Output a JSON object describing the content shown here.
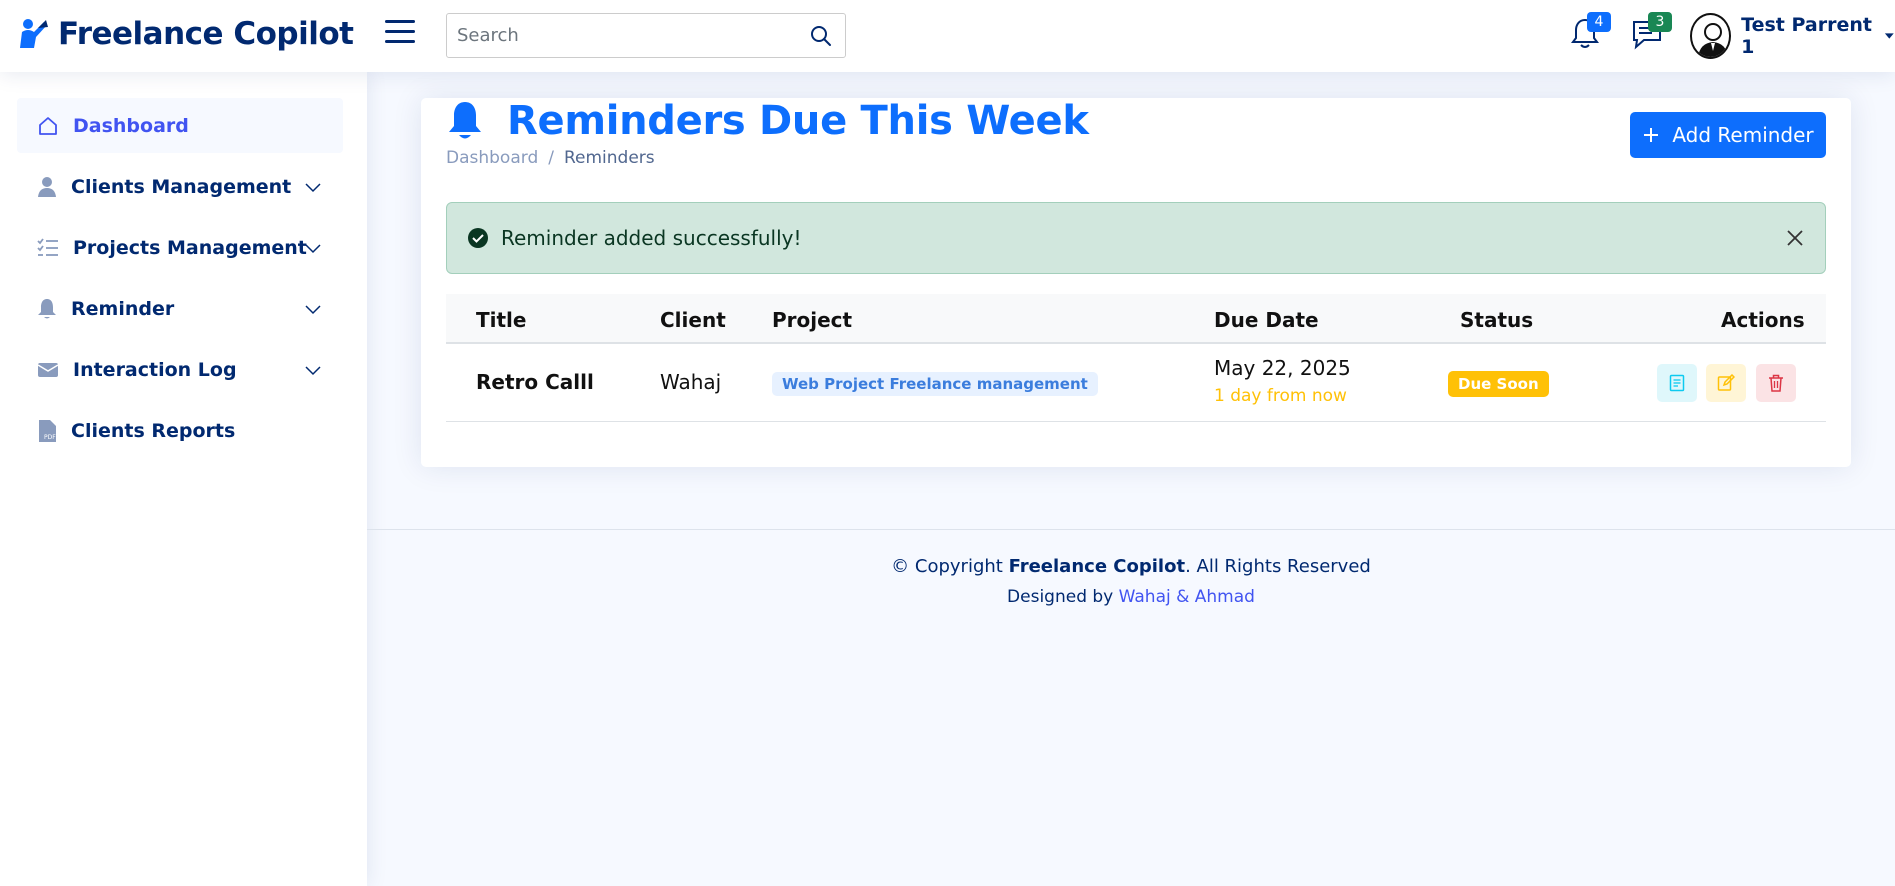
{
  "app": {
    "name": "Freelance Copilot"
  },
  "header": {
    "search_placeholder": "Search",
    "notifications_count": "4",
    "messages_count": "3",
    "user_name": "Test Parrent 1"
  },
  "sidebar": {
    "items": [
      {
        "label": "Dashboard",
        "icon": "home-icon",
        "active": true
      },
      {
        "label": "Clients Management",
        "icon": "person-icon",
        "expandable": true
      },
      {
        "label": "Projects Management",
        "icon": "list-check-icon",
        "expandable": true
      },
      {
        "label": "Reminder",
        "icon": "bell-icon",
        "expandable": true
      },
      {
        "label": "Interaction Log",
        "icon": "envelope-icon",
        "expandable": true
      },
      {
        "label": "Clients Reports",
        "icon": "pdf-file-icon"
      }
    ]
  },
  "page": {
    "title": "Reminders Due This Week",
    "breadcrumb": [
      "Dashboard",
      "Reminders"
    ],
    "add_button": "Add Reminder"
  },
  "alert": {
    "message": "Reminder added successfully!"
  },
  "table": {
    "columns": [
      "Title",
      "Client",
      "Project",
      "Due Date",
      "Status",
      "Actions"
    ],
    "rows": [
      {
        "title": "Retro Calll",
        "client": "Wahaj",
        "project": "Web Project Freelance management",
        "due_date": "May 22, 2025",
        "due_relative": "1 day from now",
        "status": "Due Soon"
      }
    ]
  },
  "footer": {
    "copyright_prefix": "© Copyright ",
    "brand": "Freelance Copilot",
    "copyright_suffix": ". All Rights Reserved",
    "designed_by": "Designed by ",
    "designers": "Wahaj & Ahmad"
  },
  "colors": {
    "primary": "#0d6efd",
    "navy": "#012970",
    "accent": "#4154f1",
    "success_bg": "#d1e7dd",
    "warning": "#ffc107"
  }
}
